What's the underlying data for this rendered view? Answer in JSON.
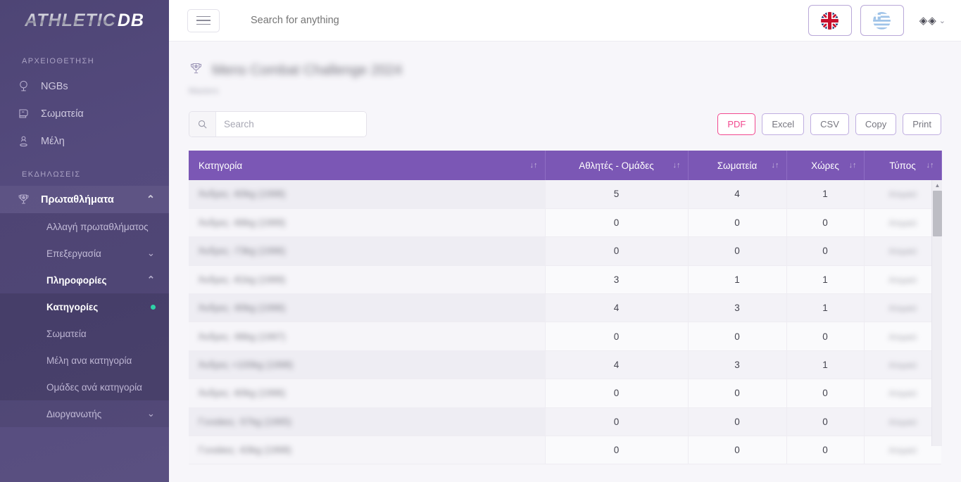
{
  "brand": {
    "part1": "ATHLETIC",
    "part2": "DB"
  },
  "sidebar": {
    "sections": [
      {
        "label": "ΑΡΧΕΙΟΘΕΤΗΣΗ"
      },
      {
        "label": "ΕΚΔΗΛΩΣΕΙΣ"
      }
    ],
    "items": [
      {
        "label": "NGBs",
        "icon": "globe-icon"
      },
      {
        "label": "Σωματεία",
        "icon": "boxing-glove-icon"
      },
      {
        "label": "Μέλη",
        "icon": "member-pin-icon"
      }
    ],
    "championships": {
      "label": "Πρωταθλήματα",
      "icon": "trophy-icon",
      "chevron": "⌃"
    },
    "submenu": [
      {
        "label": "Αλλαγή πρωταθλήματος",
        "chevron": ""
      },
      {
        "label": "Επεξεργασία",
        "chevron": "⌄"
      },
      {
        "label": "Πληροφορίες",
        "chevron": "⌃"
      }
    ],
    "info_children": [
      {
        "label": "Κατηγορίες",
        "active": true
      },
      {
        "label": "Σωματεία",
        "active": false
      },
      {
        "label": "Μέλη ανα κατηγορία",
        "active": false
      },
      {
        "label": "Ομάδες ανά κατηγορία",
        "active": false
      }
    ],
    "organizer": {
      "label": "Διοργανωτής",
      "chevron": "⌄"
    }
  },
  "topbar": {
    "search_placeholder": "Search for anything",
    "flag_en": "united-kingdom-flag",
    "flag_gr": "greece-flag",
    "user_glyphs": "◈◈",
    "user_chevron": "⌄"
  },
  "page": {
    "title": "Mens Combat Challenge 2024",
    "subtitle": "Masters"
  },
  "toolbar": {
    "search_placeholder": "Search",
    "search_value": "",
    "buttons": [
      {
        "label": "PDF",
        "accent": true
      },
      {
        "label": "Excel",
        "accent": false
      },
      {
        "label": "CSV",
        "accent": false
      },
      {
        "label": "Copy",
        "accent": false
      },
      {
        "label": "Print",
        "accent": false
      }
    ]
  },
  "table": {
    "columns": [
      {
        "label": "Κατηγορία",
        "sort": "↓↑"
      },
      {
        "label": "Αθλητές - Ομάδες",
        "sort": "↓↑"
      },
      {
        "label": "Σωματεία",
        "sort": "↓↑"
      },
      {
        "label": "Χώρες",
        "sort": "↓↑"
      },
      {
        "label": "Τύπος",
        "sort": "↓↑"
      }
    ],
    "rows": [
      {
        "category": "Άνδρες -60kg (1998)",
        "athletes": "5",
        "clubs": "4",
        "countries": "1",
        "type": "Ατομικό"
      },
      {
        "category": "Άνδρες -66kg (1999)",
        "athletes": "0",
        "clubs": "0",
        "countries": "0",
        "type": "Ατομικό"
      },
      {
        "category": "Άνδρες -73kg (1996)",
        "athletes": "0",
        "clubs": "0",
        "countries": "0",
        "type": "Ατομικό"
      },
      {
        "category": "Άνδρες -81kg (1999)",
        "athletes": "3",
        "clubs": "1",
        "countries": "1",
        "type": "Ατομικό"
      },
      {
        "category": "Άνδρες -90kg (1996)",
        "athletes": "4",
        "clubs": "3",
        "countries": "1",
        "type": "Ατομικό"
      },
      {
        "category": "Άνδρες -96kg (1997)",
        "athletes": "0",
        "clubs": "0",
        "countries": "0",
        "type": "Ατομικό"
      },
      {
        "category": "Άνδρες +100kg (1998)",
        "athletes": "4",
        "clubs": "3",
        "countries": "1",
        "type": "Ατομικό"
      },
      {
        "category": "Άνδρες -60kg (1996)",
        "athletes": "0",
        "clubs": "0",
        "countries": "0",
        "type": "Ατομικό"
      },
      {
        "category": "Γυναίκες -57kg (1995)",
        "athletes": "0",
        "clubs": "0",
        "countries": "0",
        "type": "Ατομικό"
      },
      {
        "category": "Γυναίκες -63kg (1998)",
        "athletes": "0",
        "clubs": "0",
        "countries": "0",
        "type": "Ατομικό"
      }
    ]
  },
  "scrollbar": {
    "up_arrow": "▲"
  },
  "colors": {
    "sidebar": "#544a7d",
    "table_header": "#7b57b5",
    "accent_pink": "#f2488f",
    "active_dot": "#2ed3a7",
    "page_bg": "#f7f6fa"
  }
}
